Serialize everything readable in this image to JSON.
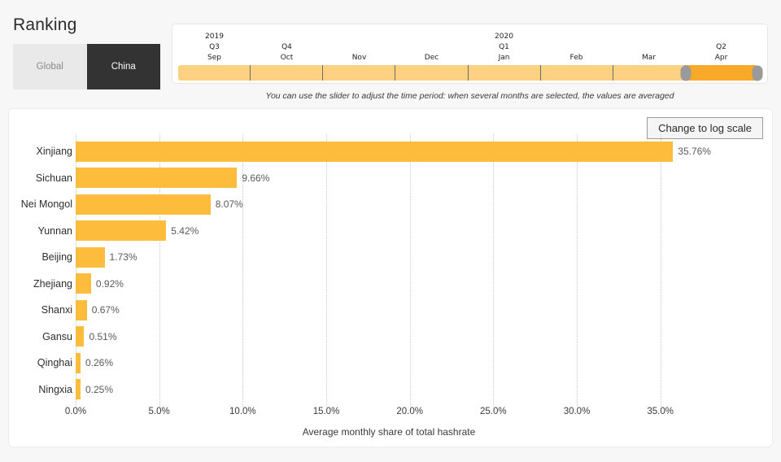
{
  "header": {
    "title": "Ranking",
    "toggle": {
      "options": [
        {
          "label": "Global",
          "active": false
        },
        {
          "label": "China",
          "active": true
        }
      ]
    }
  },
  "slider": {
    "hint": "You can use the slider to adjust the time period: when several months are selected, the values are averaged",
    "segments": [
      {
        "year": "2019",
        "quarter": "Q3",
        "month": "Sep",
        "selected": false
      },
      {
        "year": "",
        "quarter": "Q4",
        "month": "Oct",
        "selected": false
      },
      {
        "year": "",
        "quarter": "",
        "month": "Nov",
        "selected": false
      },
      {
        "year": "",
        "quarter": "",
        "month": "Dec",
        "selected": false
      },
      {
        "year": "2020",
        "quarter": "Q1",
        "month": "Jan",
        "selected": false
      },
      {
        "year": "",
        "quarter": "",
        "month": "Feb",
        "selected": false
      },
      {
        "year": "",
        "quarter": "",
        "month": "Mar",
        "selected": false
      },
      {
        "year": "",
        "quarter": "Q2",
        "month": "Apr",
        "selected": true
      }
    ],
    "selected_range": {
      "start": "Apr",
      "end": "Apr"
    },
    "track_color": "#fcd182",
    "selected_color": "#f9a92a",
    "handle_color": "#9a9a9a"
  },
  "chart_panel": {
    "log_scale_button": "Change to log scale"
  },
  "chart_data": {
    "type": "bar",
    "orientation": "horizontal",
    "title": "",
    "xlabel": "Average monthly share of total hashrate",
    "ylabel": "",
    "categories": [
      "Xinjiang",
      "Sichuan",
      "Nei Mongol",
      "Yunnan",
      "Beijing",
      "Zhejiang",
      "Shanxi",
      "Gansu",
      "Qinghai",
      "Ningxia"
    ],
    "values": [
      35.76,
      9.66,
      8.07,
      5.42,
      1.73,
      0.92,
      0.67,
      0.51,
      0.26,
      0.25
    ],
    "value_labels": [
      "35.76%",
      "9.66%",
      "8.07%",
      "5.42%",
      "1.73%",
      "0.92%",
      "0.67%",
      "0.51%",
      "0.26%",
      "0.25%"
    ],
    "unit": "%",
    "xlim": [
      0,
      37.5
    ],
    "xticks": [
      0,
      5,
      10,
      15,
      20,
      25,
      30,
      35
    ],
    "xtick_labels": [
      "0.0%",
      "5.0%",
      "10.0%",
      "15.0%",
      "20.0%",
      "25.0%",
      "30.0%",
      "35.0%"
    ],
    "grid": true,
    "grid_axis": "x",
    "grid_style": "dotted",
    "legend": false,
    "bar_color": "#fdbc3c",
    "scale": "linear"
  }
}
